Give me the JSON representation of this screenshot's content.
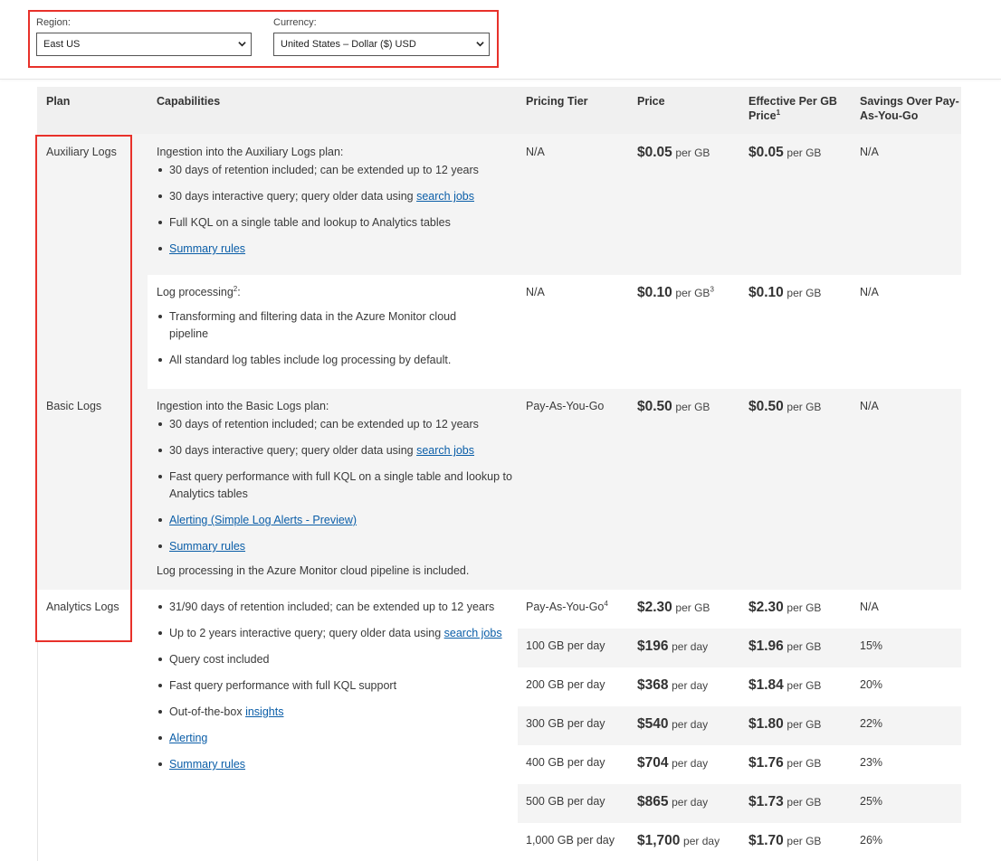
{
  "filters": {
    "region_label": "Region:",
    "region_value": "East US",
    "currency_label": "Currency:",
    "currency_value": "United States – Dollar ($) USD"
  },
  "table": {
    "headers": {
      "plan": "Plan",
      "capabilities": "Capabilities",
      "tier": "Pricing Tier",
      "price": "Price",
      "effective": "Effective Per GB Price",
      "effective_sup": "1",
      "savings": "Savings Over Pay-As-You-Go"
    },
    "auxiliary": {
      "plan": "Auxiliary Logs",
      "intro": "Ingestion into the Auxiliary Logs plan:",
      "bullets": [
        "30 days of retention included; can be extended up to 12 years",
        "30 days interactive query; query older data using ",
        "Full KQL on a single table and lookup to Analytics tables"
      ],
      "link_search_jobs": "search jobs",
      "link_summary": "Summary rules",
      "tier": "N/A",
      "price_amount": "$0.05",
      "price_unit": "per GB",
      "eff_amount": "$0.05",
      "eff_unit": "per GB",
      "savings": "N/A"
    },
    "processing": {
      "intro": "Log processing",
      "intro_sup": "2",
      "intro_tail": ":",
      "bullets": [
        "Transforming and filtering data in the Azure Monitor cloud pipeline",
        "All standard log tables include log processing by default."
      ],
      "tier": "N/A",
      "price_amount": "$0.10",
      "price_unit": "per GB",
      "price_sup": "3",
      "eff_amount": "$0.10",
      "eff_unit": "per GB",
      "savings": "N/A"
    },
    "basic": {
      "plan": "Basic Logs",
      "intro": "Ingestion into the Basic Logs plan:",
      "bullets": [
        "30 days of retention included; can be extended up to 12 years",
        "30 days interactive query; query older data using ",
        "Fast query performance with full KQL on a single table and lookup to Analytics tables"
      ],
      "link_search_jobs": "search jobs",
      "link_alerting": "Alerting (Simple Log Alerts - Preview)",
      "link_summary": "Summary rules",
      "footer": "Log processing in the Azure Monitor cloud pipeline is included.",
      "tier": "Pay-As-You-Go",
      "price_amount": "$0.50",
      "price_unit": "per GB",
      "eff_amount": "$0.50",
      "eff_unit": "per GB",
      "savings": "N/A"
    },
    "analytics": {
      "plan": "Analytics Logs",
      "bullets": [
        "31/90 days of retention included; can be extended up to 12 years",
        "Up to 2 years interactive query; query older data using ",
        "Query cost included",
        "Fast query performance with full KQL support",
        "Out-of-the-box "
      ],
      "link_search_jobs": "search jobs",
      "link_insights": "insights",
      "link_alerting": "Alerting",
      "link_summary": "Summary rules",
      "tiers": [
        {
          "tier": "Pay-As-You-Go",
          "tier_sup": "4",
          "price": "$2.30",
          "price_unit": "per GB",
          "eff": "$2.30",
          "eff_unit": "per GB",
          "savings": "N/A"
        },
        {
          "tier": "100 GB per day",
          "tier_sup": "",
          "price": "$196",
          "price_unit": "per day",
          "eff": "$1.96",
          "eff_unit": "per GB",
          "savings": "15%"
        },
        {
          "tier": "200 GB per day",
          "tier_sup": "",
          "price": "$368",
          "price_unit": "per day",
          "eff": "$1.84",
          "eff_unit": "per GB",
          "savings": "20%"
        },
        {
          "tier": "300 GB per day",
          "tier_sup": "",
          "price": "$540",
          "price_unit": "per day",
          "eff": "$1.80",
          "eff_unit": "per GB",
          "savings": "22%"
        },
        {
          "tier": "400 GB per day",
          "tier_sup": "",
          "price": "$704",
          "price_unit": "per day",
          "eff": "$1.76",
          "eff_unit": "per GB",
          "savings": "23%"
        },
        {
          "tier": "500 GB per day",
          "tier_sup": "",
          "price": "$865",
          "price_unit": "per day",
          "eff": "$1.73",
          "eff_unit": "per GB",
          "savings": "25%"
        },
        {
          "tier": "1,000 GB per day",
          "tier_sup": "",
          "price": "$1,700",
          "price_unit": "per day",
          "eff": "$1.70",
          "eff_unit": "per GB",
          "savings": "26%"
        }
      ]
    }
  },
  "icons": {
    "dropdown": "chevron-down-icon"
  }
}
